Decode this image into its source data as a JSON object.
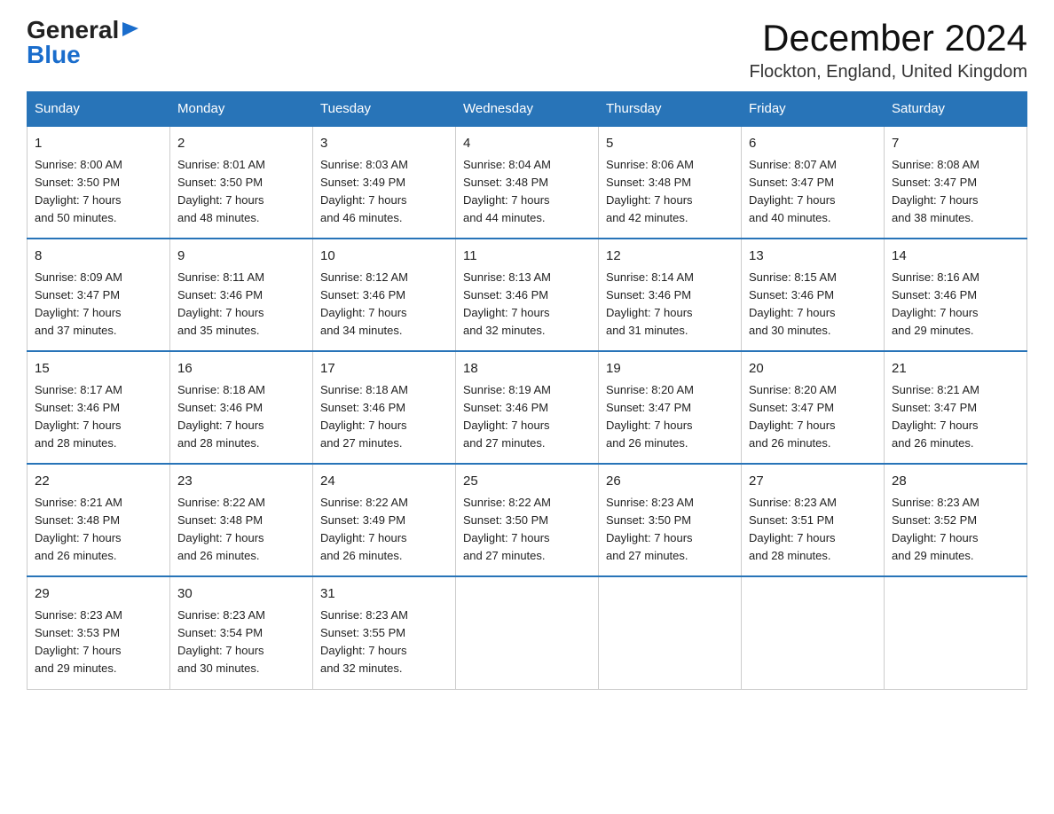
{
  "header": {
    "logo": {
      "general": "General",
      "blue": "Blue",
      "arrow": "▶"
    },
    "title": "December 2024",
    "location": "Flockton, England, United Kingdom"
  },
  "weekdays": [
    "Sunday",
    "Monday",
    "Tuesday",
    "Wednesday",
    "Thursday",
    "Friday",
    "Saturday"
  ],
  "weeks": [
    [
      {
        "day": "1",
        "sunrise": "8:00 AM",
        "sunset": "3:50 PM",
        "daylight": "7 hours and 50 minutes."
      },
      {
        "day": "2",
        "sunrise": "8:01 AM",
        "sunset": "3:50 PM",
        "daylight": "7 hours and 48 minutes."
      },
      {
        "day": "3",
        "sunrise": "8:03 AM",
        "sunset": "3:49 PM",
        "daylight": "7 hours and 46 minutes."
      },
      {
        "day": "4",
        "sunrise": "8:04 AM",
        "sunset": "3:48 PM",
        "daylight": "7 hours and 44 minutes."
      },
      {
        "day": "5",
        "sunrise": "8:06 AM",
        "sunset": "3:48 PM",
        "daylight": "7 hours and 42 minutes."
      },
      {
        "day": "6",
        "sunrise": "8:07 AM",
        "sunset": "3:47 PM",
        "daylight": "7 hours and 40 minutes."
      },
      {
        "day": "7",
        "sunrise": "8:08 AM",
        "sunset": "3:47 PM",
        "daylight": "7 hours and 38 minutes."
      }
    ],
    [
      {
        "day": "8",
        "sunrise": "8:09 AM",
        "sunset": "3:47 PM",
        "daylight": "7 hours and 37 minutes."
      },
      {
        "day": "9",
        "sunrise": "8:11 AM",
        "sunset": "3:46 PM",
        "daylight": "7 hours and 35 minutes."
      },
      {
        "day": "10",
        "sunrise": "8:12 AM",
        "sunset": "3:46 PM",
        "daylight": "7 hours and 34 minutes."
      },
      {
        "day": "11",
        "sunrise": "8:13 AM",
        "sunset": "3:46 PM",
        "daylight": "7 hours and 32 minutes."
      },
      {
        "day": "12",
        "sunrise": "8:14 AM",
        "sunset": "3:46 PM",
        "daylight": "7 hours and 31 minutes."
      },
      {
        "day": "13",
        "sunrise": "8:15 AM",
        "sunset": "3:46 PM",
        "daylight": "7 hours and 30 minutes."
      },
      {
        "day": "14",
        "sunrise": "8:16 AM",
        "sunset": "3:46 PM",
        "daylight": "7 hours and 29 minutes."
      }
    ],
    [
      {
        "day": "15",
        "sunrise": "8:17 AM",
        "sunset": "3:46 PM",
        "daylight": "7 hours and 28 minutes."
      },
      {
        "day": "16",
        "sunrise": "8:18 AM",
        "sunset": "3:46 PM",
        "daylight": "7 hours and 28 minutes."
      },
      {
        "day": "17",
        "sunrise": "8:18 AM",
        "sunset": "3:46 PM",
        "daylight": "7 hours and 27 minutes."
      },
      {
        "day": "18",
        "sunrise": "8:19 AM",
        "sunset": "3:46 PM",
        "daylight": "7 hours and 27 minutes."
      },
      {
        "day": "19",
        "sunrise": "8:20 AM",
        "sunset": "3:47 PM",
        "daylight": "7 hours and 26 minutes."
      },
      {
        "day": "20",
        "sunrise": "8:20 AM",
        "sunset": "3:47 PM",
        "daylight": "7 hours and 26 minutes."
      },
      {
        "day": "21",
        "sunrise": "8:21 AM",
        "sunset": "3:47 PM",
        "daylight": "7 hours and 26 minutes."
      }
    ],
    [
      {
        "day": "22",
        "sunrise": "8:21 AM",
        "sunset": "3:48 PM",
        "daylight": "7 hours and 26 minutes."
      },
      {
        "day": "23",
        "sunrise": "8:22 AM",
        "sunset": "3:48 PM",
        "daylight": "7 hours and 26 minutes."
      },
      {
        "day": "24",
        "sunrise": "8:22 AM",
        "sunset": "3:49 PM",
        "daylight": "7 hours and 26 minutes."
      },
      {
        "day": "25",
        "sunrise": "8:22 AM",
        "sunset": "3:50 PM",
        "daylight": "7 hours and 27 minutes."
      },
      {
        "day": "26",
        "sunrise": "8:23 AM",
        "sunset": "3:50 PM",
        "daylight": "7 hours and 27 minutes."
      },
      {
        "day": "27",
        "sunrise": "8:23 AM",
        "sunset": "3:51 PM",
        "daylight": "7 hours and 28 minutes."
      },
      {
        "day": "28",
        "sunrise": "8:23 AM",
        "sunset": "3:52 PM",
        "daylight": "7 hours and 29 minutes."
      }
    ],
    [
      {
        "day": "29",
        "sunrise": "8:23 AM",
        "sunset": "3:53 PM",
        "daylight": "7 hours and 29 minutes."
      },
      {
        "day": "30",
        "sunrise": "8:23 AM",
        "sunset": "3:54 PM",
        "daylight": "7 hours and 30 minutes."
      },
      {
        "day": "31",
        "sunrise": "8:23 AM",
        "sunset": "3:55 PM",
        "daylight": "7 hours and 32 minutes."
      },
      null,
      null,
      null,
      null
    ]
  ],
  "labels": {
    "sunrise": "Sunrise:",
    "sunset": "Sunset:",
    "daylight": "Daylight:"
  }
}
